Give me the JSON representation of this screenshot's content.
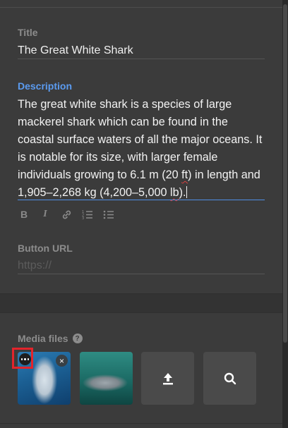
{
  "title_field": {
    "label": "Title",
    "value": "The Great White Shark"
  },
  "description_field": {
    "label": "Description",
    "text_before": "The great white shark is a species of large mackerel shark which can be found in the coastal surface waters of all the major oceans. It is notable for its size, with larger female individuals growing to 6.1 m (20 ",
    "flagged_1": "ft",
    "text_middle": ") in length and 1,905–2,268 kg (4,200–5,000 ",
    "flagged_2": "lb",
    "text_after": ")."
  },
  "editor_toolbar": {
    "bold_icon": "B",
    "italic_icon": "I",
    "link_icon": "link-icon",
    "ordered_list_icon": "ordered-list-icon",
    "bullet_list_icon": "bullet-list-icon"
  },
  "button_url_field": {
    "label": "Button URL",
    "placeholder": "https://"
  },
  "media": {
    "label": "Media files",
    "help_icon": "?",
    "remove_icon": "×",
    "items": [
      {
        "name": "great-white-shark-photo-1"
      },
      {
        "name": "great-white-shark-photo-2"
      }
    ],
    "upload_icon": "upload-icon",
    "search_icon": "search-icon"
  },
  "colors": {
    "accent": "#5b9bf0",
    "highlight": "#e3242b",
    "background": "#3b3b3b"
  }
}
